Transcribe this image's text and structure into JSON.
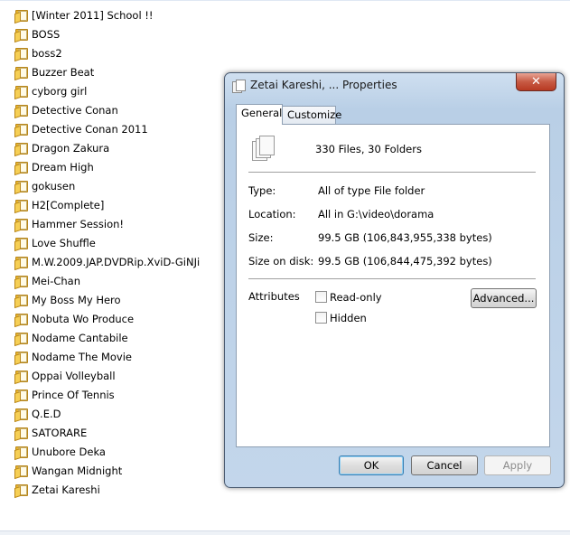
{
  "explorer": {
    "folders": [
      "[Winter 2011] School !!",
      "BOSS",
      "boss2",
      "Buzzer Beat",
      "cyborg girl",
      "Detective Conan",
      "Detective Conan 2011",
      "Dragon Zakura",
      "Dream High",
      "gokusen",
      "H2[Complete]",
      "Hammer Session!",
      "Love Shuffle",
      "M.W.2009.JAP.DVDRip.XviD-GiNJi",
      "Mei-Chan",
      "My Boss My Hero",
      "Nobuta Wo Produce",
      "Nodame Cantabile",
      "Nodame The Movie",
      "Oppai Volleyball",
      "Prince Of Tennis",
      "Q.E.D",
      "SATORARE",
      "Unubore Deka",
      "Wangan Midnight",
      "Zetai Kareshi"
    ],
    "folder_icon": "folder-icon"
  },
  "dialog": {
    "title": "Zetai Kareshi, ... Properties",
    "close_glyph": "✕",
    "tabs": [
      "General",
      "Customize"
    ],
    "active_tab": "General",
    "summary": "330 Files, 30 Folders",
    "properties": {
      "type_label": "Type:",
      "type_value": "All of type File folder",
      "location_label": "Location:",
      "location_value": "All in G:\\video\\dorama",
      "size_label": "Size:",
      "size_value": "99.5 GB (106,843,955,338 bytes)",
      "size_on_disk_label": "Size on disk:",
      "size_on_disk_value": "99.5 GB (106,844,475,392 bytes)"
    },
    "attributes": {
      "label": "Attributes",
      "readonly_label": "Read-only",
      "readonly_checked": false,
      "hidden_label": "Hidden",
      "hidden_checked": false,
      "advanced_label": "Advanced..."
    },
    "buttons": {
      "ok": "OK",
      "cancel": "Cancel",
      "apply": "Apply",
      "apply_enabled": false
    }
  },
  "colors": {
    "folder": "#e8b52c",
    "close_button": "#c75a44",
    "dialog_frame": "#b9cfe6"
  }
}
